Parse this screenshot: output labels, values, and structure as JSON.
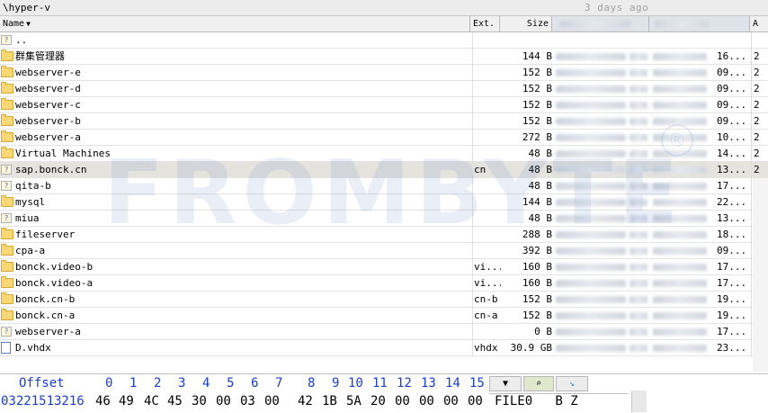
{
  "path": "\\hyper-v",
  "relative_time": "3 days ago",
  "columns": {
    "name": "Name",
    "ext": "Ext.",
    "size": "Size",
    "last": "A"
  },
  "rows": [
    {
      "name": "..",
      "ext": "",
      "size": "",
      "tail": "",
      "last": "",
      "icon": "parent-folder-icon",
      "selected": false
    },
    {
      "name": "群集管理器",
      "ext": "",
      "size": "144 B",
      "tail": "16...",
      "last": "2",
      "icon": "folder-icon",
      "selected": false
    },
    {
      "name": "webserver-e",
      "ext": "",
      "size": "152 B",
      "tail": "09...",
      "last": "2",
      "icon": "folder-icon",
      "selected": false
    },
    {
      "name": "webserver-d",
      "ext": "",
      "size": "152 B",
      "tail": "09...",
      "last": "2",
      "icon": "folder-icon",
      "selected": false
    },
    {
      "name": "webserver-c",
      "ext": "",
      "size": "152 B",
      "tail": "09...",
      "last": "2",
      "icon": "folder-icon",
      "selected": false
    },
    {
      "name": "webserver-b",
      "ext": "",
      "size": "152 B",
      "tail": "09...",
      "last": "2",
      "icon": "folder-icon",
      "selected": false
    },
    {
      "name": "webserver-a",
      "ext": "",
      "size": "272 B",
      "tail": "10...",
      "last": "2",
      "icon": "folder-icon",
      "selected": false
    },
    {
      "name": "Virtual Machines",
      "ext": "",
      "size": "48 B",
      "tail": "14...",
      "last": "2",
      "icon": "folder-icon",
      "selected": false
    },
    {
      "name": "sap.bonck.cn",
      "ext": "cn",
      "size": "48 B",
      "tail": "13...",
      "last": "2",
      "icon": "unknown-folder-icon",
      "selected": true
    },
    {
      "name": "qita-b",
      "ext": "",
      "size": "48 B",
      "tail": "17...",
      "last": "",
      "icon": "unknown-folder-icon",
      "selected": false
    },
    {
      "name": "mysql",
      "ext": "",
      "size": "144 B",
      "tail": "22...",
      "last": "",
      "icon": "folder-icon",
      "selected": false
    },
    {
      "name": "miua",
      "ext": "",
      "size": "48 B",
      "tail": "13...",
      "last": "",
      "icon": "unknown-folder-icon",
      "selected": false
    },
    {
      "name": "fileserver",
      "ext": "",
      "size": "288 B",
      "tail": "18...",
      "last": "",
      "icon": "folder-icon",
      "selected": false
    },
    {
      "name": "cpa-a",
      "ext": "",
      "size": "392 B",
      "tail": "09...",
      "last": "",
      "icon": "folder-icon",
      "selected": false
    },
    {
      "name": "bonck.video-b",
      "ext": "vi...",
      "size": "160 B",
      "tail": "17...",
      "last": "",
      "icon": "folder-icon",
      "selected": false
    },
    {
      "name": "bonck.video-a",
      "ext": "vi...",
      "size": "160 B",
      "tail": "17...",
      "last": "",
      "icon": "folder-icon",
      "selected": false
    },
    {
      "name": "bonck.cn-b",
      "ext": "cn-b",
      "size": "152 B",
      "tail": "19...",
      "last": "",
      "icon": "folder-icon",
      "selected": false
    },
    {
      "name": "bonck.cn-a",
      "ext": "cn-a",
      "size": "152 B",
      "tail": "19...",
      "last": "",
      "icon": "folder-icon",
      "selected": false
    },
    {
      "name": "webserver-a",
      "ext": "",
      "size": "0 B",
      "tail": "17...",
      "last": "",
      "icon": "unknown-file-icon",
      "selected": false
    },
    {
      "name": "D.vhdx",
      "ext": "vhdx",
      "size": "30.9 GB",
      "tail": "23...",
      "last": "",
      "icon": "file-icon",
      "selected": false
    }
  ],
  "watermark": "FROMBYTE",
  "watermark_mark": "®",
  "hex": {
    "offset_label": "Offset",
    "column_labels": [
      "0",
      "1",
      "2",
      "3",
      "4",
      "5",
      "6",
      "7",
      "8",
      "9",
      "10",
      "11",
      "12",
      "13",
      "14",
      "15"
    ],
    "offset_value": "03221513216",
    "bytes": [
      "46",
      "49",
      "4C",
      "45",
      "30",
      "00",
      "03",
      "00",
      "42",
      "1B",
      "5A",
      "20",
      "00",
      "00",
      "00",
      "00"
    ],
    "ascii": "FILE0   B Z"
  }
}
